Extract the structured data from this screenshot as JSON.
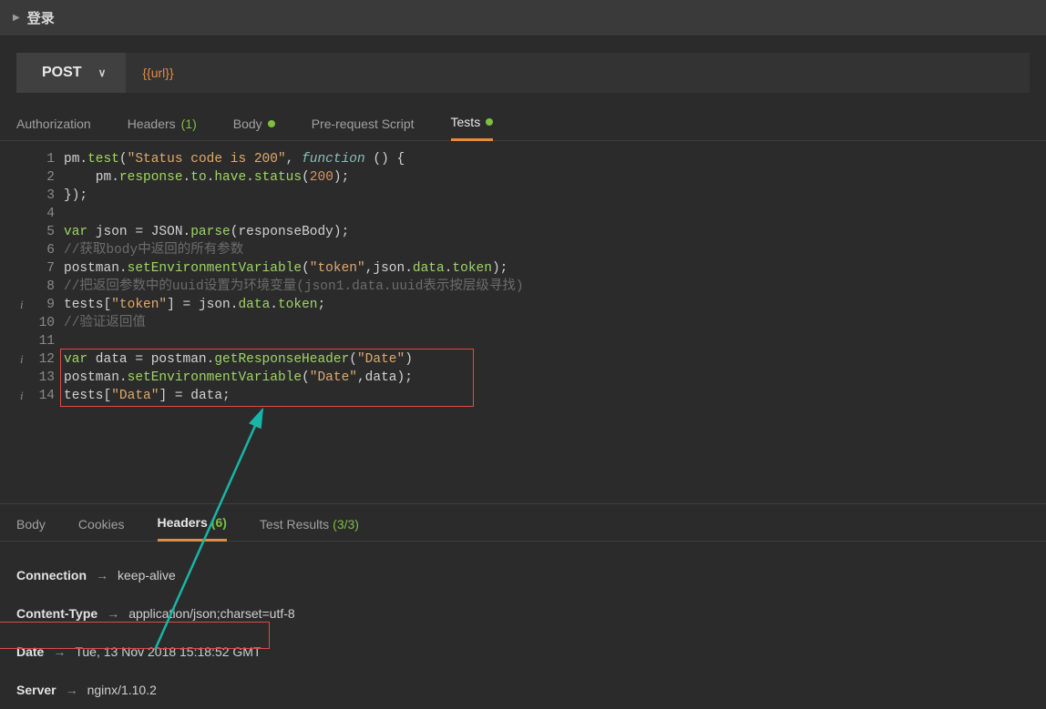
{
  "title": "登录",
  "request": {
    "method": "POST",
    "url": "{{url}}"
  },
  "reqTabs": {
    "authorization": "Authorization",
    "headers": "Headers",
    "headersCount": "(1)",
    "body": "Body",
    "preRequest": "Pre-request Script",
    "tests": "Tests"
  },
  "code": {
    "l1a": "pm.",
    "l1b": "test",
    "l1c": "(",
    "l1d": "\"Status code is 200\"",
    "l1e": ", ",
    "l1f": "function",
    "l1g": " () {",
    "l2a": "    pm.",
    "l2b": "response",
    "l2c": ".",
    "l2d": "to",
    "l2e": ".",
    "l2f": "have",
    "l2g": ".",
    "l2h": "status",
    "l2i": "(",
    "l2j": "200",
    "l2k": ");",
    "l3": "});",
    "l5a": "var",
    "l5b": " json = JSON.",
    "l5c": "parse",
    "l5d": "(responseBody);",
    "l6": "//获取body中返回的所有参数",
    "l7a": "postman.",
    "l7b": "setEnvironmentVariable",
    "l7c": "(",
    "l7d": "\"token\"",
    "l7e": ",json.",
    "l7f": "data",
    "l7g": ".",
    "l7h": "token",
    "l7i": ");",
    "l8": "//把返回参数中的uuid设置为环境变量(json1.data.uuid表示按层级寻找)",
    "l9a": "tests[",
    "l9b": "\"token\"",
    "l9c": "] = json.",
    "l9d": "data",
    "l9e": ".",
    "l9f": "token",
    "l9g": ";",
    "l10": "//验证返回值",
    "l12a": "var",
    "l12b": " data = postman.",
    "l12c": "getResponseHeader",
    "l12d": "(",
    "l12e": "\"Date\"",
    "l12f": ")",
    "l13a": "postman.",
    "l13b": "setEnvironmentVariable",
    "l13c": "(",
    "l13d": "\"Date\"",
    "l13e": ",data);",
    "l14a": "tests[",
    "l14b": "\"Data\"",
    "l14c": "] = data;"
  },
  "gutter": {
    "n1": "1",
    "n2": "2",
    "n3": "3",
    "n4": "4",
    "n5": "5",
    "n6": "6",
    "n7": "7",
    "n8": "8",
    "n9": "9",
    "n10": "10",
    "n11": "11",
    "n12": "12",
    "n13": "13",
    "n14": "14"
  },
  "resTabs": {
    "body": "Body",
    "cookies": "Cookies",
    "headers": "Headers",
    "headersCount": "(6)",
    "testResults": "Test Results",
    "testResultsCount": "(3/3)"
  },
  "headers": [
    {
      "name": "Connection",
      "value": "keep-alive"
    },
    {
      "name": "Content-Type",
      "value": "application/json;charset=utf-8"
    },
    {
      "name": "Date",
      "value": "Tue, 13 Nov 2018 15:18:52 GMT"
    },
    {
      "name": "Server",
      "value": "nginx/1.10.2"
    }
  ]
}
